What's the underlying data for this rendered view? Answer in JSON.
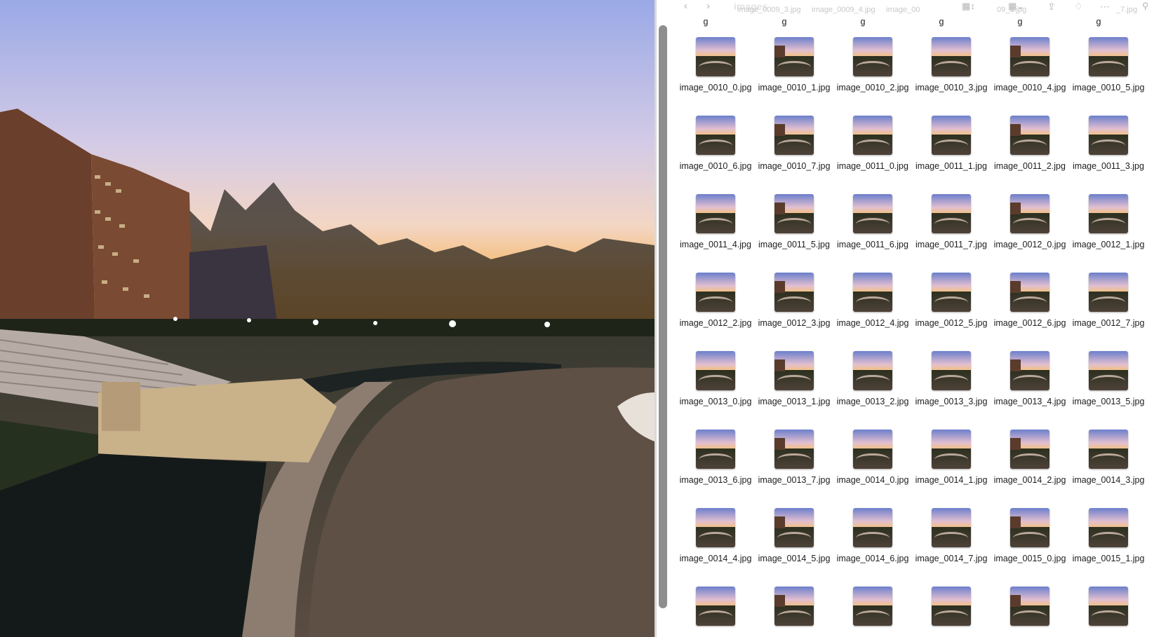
{
  "finder": {
    "title": "images",
    "toolbar_icons": [
      "chevron-left-icon",
      "chevron-right-icon",
      "grid-view-icon",
      "group-icon",
      "share-icon",
      "tag-icon",
      "more-icon",
      "search-icon"
    ],
    "ghost_header": [
      "g_2.jpg",
      "image_0009_3.jpg",
      "image_0009_4.jpg",
      "image_00",
      "09_1.jpg",
      "_7.jpg"
    ],
    "partial_row": [
      "g",
      "g",
      "g",
      "g",
      "g",
      "g"
    ],
    "files": [
      "image_0010_0.jpg",
      "image_0010_1.jpg",
      "image_0010_2.jpg",
      "image_0010_3.jpg",
      "image_0010_4.jpg",
      "image_0010_5.jpg",
      "image_0010_6.jpg",
      "image_0010_7.jpg",
      "image_0011_0.jpg",
      "image_0011_1.jpg",
      "image_0011_2.jpg",
      "image_0011_3.jpg",
      "image_0011_4.jpg",
      "image_0011_5.jpg",
      "image_0011_6.jpg",
      "image_0011_7.jpg",
      "image_0012_0.jpg",
      "image_0012_1.jpg",
      "image_0012_2.jpg",
      "image_0012_3.jpg",
      "image_0012_4.jpg",
      "image_0012_5.jpg",
      "image_0012_6.jpg",
      "image_0012_7.jpg",
      "image_0013_0.jpg",
      "image_0013_1.jpg",
      "image_0013_2.jpg",
      "image_0013_3.jpg",
      "image_0013_4.jpg",
      "image_0013_5.jpg",
      "image_0013_6.jpg",
      "image_0013_7.jpg",
      "image_0014_0.jpg",
      "image_0014_1.jpg",
      "image_0014_2.jpg",
      "image_0014_3.jpg",
      "image_0014_4.jpg",
      "image_0014_5.jpg",
      "image_0014_6.jpg",
      "image_0014_7.jpg",
      "image_0015_0.jpg",
      "image_0015_1.jpg",
      "",
      "",
      "",
      "",
      "",
      ""
    ]
  }
}
